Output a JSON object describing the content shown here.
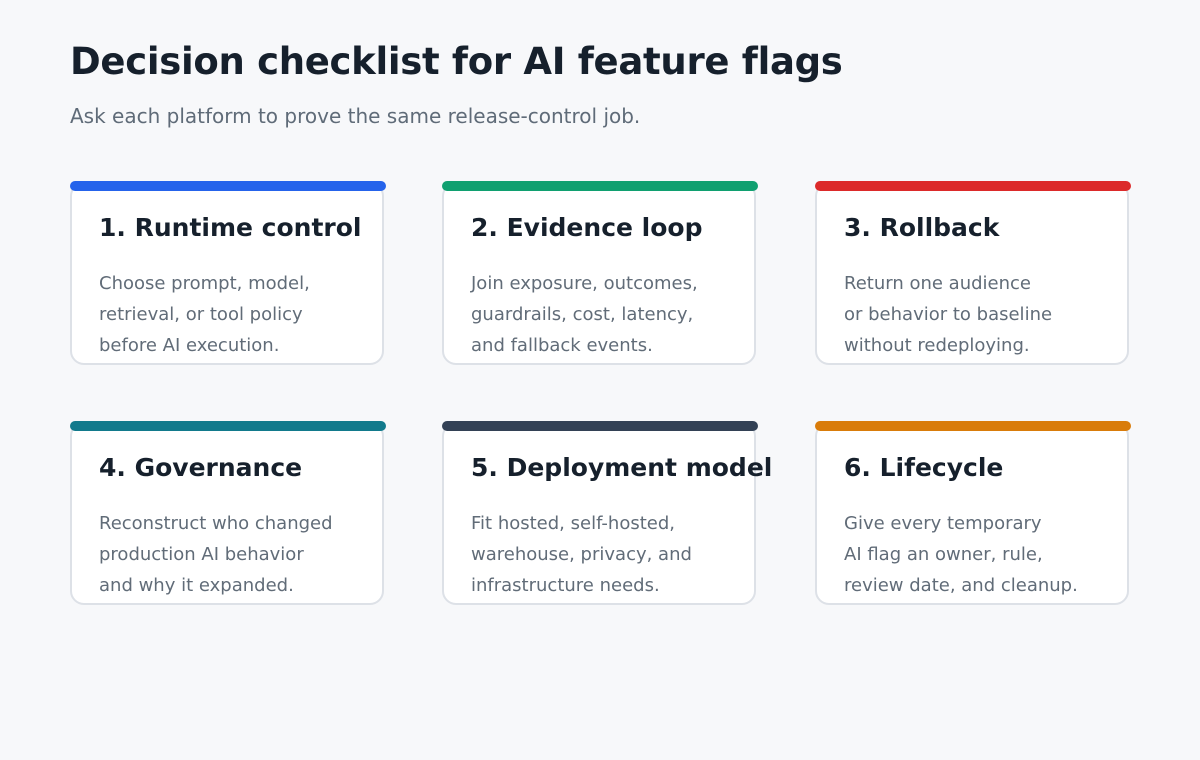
{
  "header": {
    "title": "Decision checklist for AI feature flags",
    "subtitle": "Ask each platform to prove the same release-control job."
  },
  "cards": [
    {
      "title": "1. Runtime control",
      "accent": "#2563eb",
      "lines": [
        "Choose prompt, model,",
        "retrieval, or tool policy",
        "before AI execution."
      ]
    },
    {
      "title": "2. Evidence loop",
      "accent": "#10a070",
      "lines": [
        "Join exposure, outcomes,",
        "guardrails, cost, latency,",
        "and fallback events."
      ]
    },
    {
      "title": "3. Rollback",
      "accent": "#dc2a2a",
      "lines": [
        "Return one audience",
        "or behavior to baseline",
        "without redeploying."
      ]
    },
    {
      "title": "4. Governance",
      "accent": "#127a8c",
      "lines": [
        "Reconstruct who changed",
        "production AI behavior",
        "and why it expanded."
      ]
    },
    {
      "title": "5. Deployment model",
      "accent": "#334155",
      "lines": [
        "Fit hosted, self-hosted,",
        "warehouse, privacy, and",
        "infrastructure needs."
      ]
    },
    {
      "title": "6. Lifecycle",
      "accent": "#d97c0a",
      "lines": [
        "Give every temporary",
        "AI flag an owner, rule,",
        "review date, and cleanup."
      ]
    }
  ]
}
